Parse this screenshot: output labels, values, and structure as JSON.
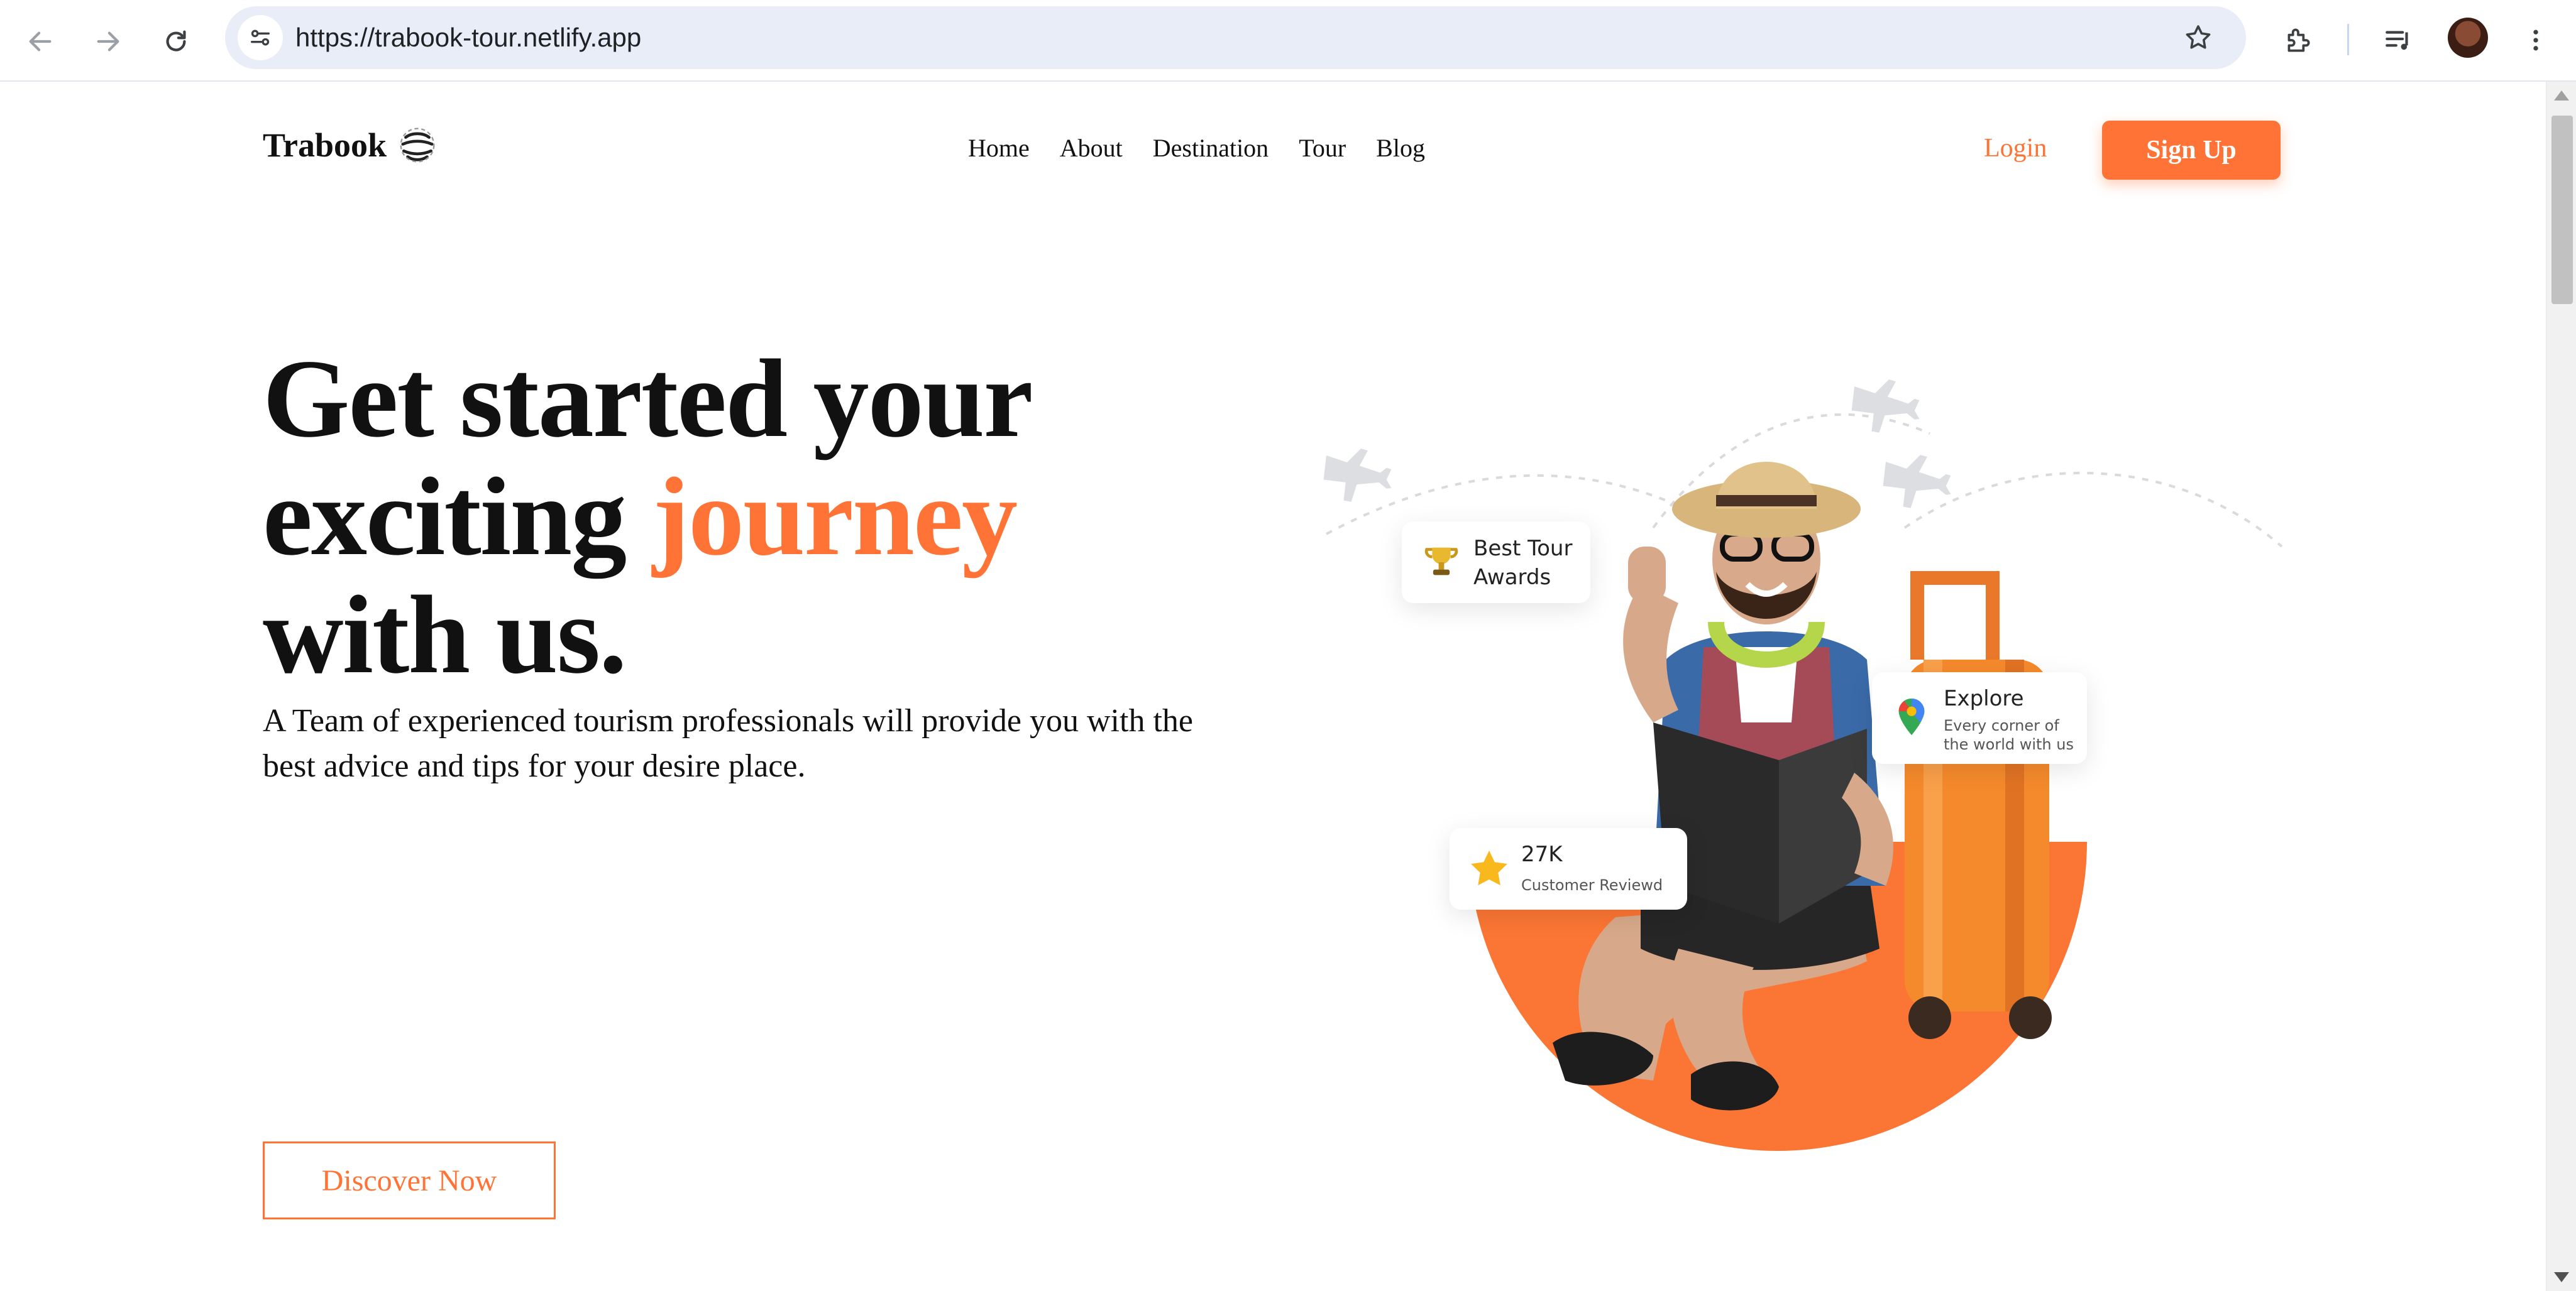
{
  "browser": {
    "url": "https://trabook-tour.netlify.app"
  },
  "site": {
    "logo_text": "Trabook",
    "nav": [
      "Home",
      "About",
      "Destination",
      "Tour",
      "Blog"
    ],
    "login_label": "Login",
    "signup_label": "Sign Up"
  },
  "hero": {
    "title_line1": "Get started your",
    "title_line2_prefix": "exciting ",
    "title_accent": "journey",
    "title_line3": "with us.",
    "subtitle": "A Team of experienced tourism professionals will provide you with the best advice and tips for your desire place.",
    "cta_label": "Discover Now"
  },
  "badges": {
    "awards": {
      "title": "Best Tour Awards"
    },
    "explore": {
      "title": "Explore",
      "caption": "Every corner of the world with us"
    },
    "reviews": {
      "count": "27K",
      "caption": "Customer Reviewd"
    }
  },
  "colors": {
    "accent": "#ff7436",
    "text": "#111111",
    "omnibox": "#e9edf7"
  },
  "icons": [
    "back-arrow-icon",
    "forward-arrow-icon",
    "reload-icon",
    "site-info-icon",
    "bookmark-star-icon",
    "extensions-icon",
    "reading-list-icon",
    "kebab-menu-icon",
    "globe-logo-icon",
    "trophy-icon",
    "map-pin-icon",
    "star-icon",
    "airplane-icon"
  ]
}
